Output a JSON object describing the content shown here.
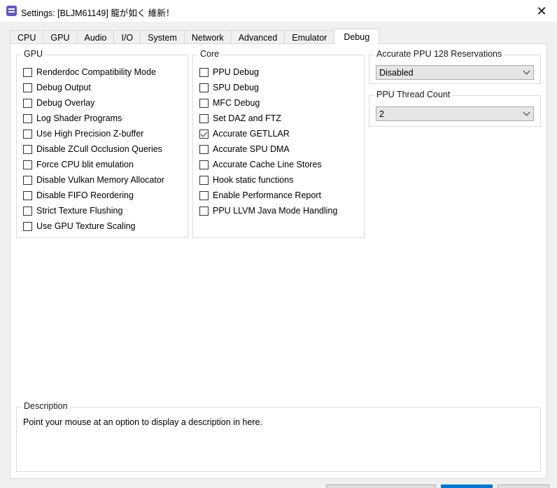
{
  "window": {
    "title": "Settings: [BLJM61149] 龍が如く 維新！",
    "close_glyph": "✕"
  },
  "tabs": [
    {
      "label": "CPU",
      "active": false
    },
    {
      "label": "GPU",
      "active": false
    },
    {
      "label": "Audio",
      "active": false
    },
    {
      "label": "I/O",
      "active": false
    },
    {
      "label": "System",
      "active": false
    },
    {
      "label": "Network",
      "active": false
    },
    {
      "label": "Advanced",
      "active": false
    },
    {
      "label": "Emulator",
      "active": false
    },
    {
      "label": "Debug",
      "active": true
    }
  ],
  "gpu_group": {
    "title": "GPU",
    "options": [
      {
        "label": "Renderdoc Compatibility Mode",
        "checked": false
      },
      {
        "label": "Debug Output",
        "checked": false
      },
      {
        "label": "Debug Overlay",
        "checked": false
      },
      {
        "label": "Log Shader Programs",
        "checked": false
      },
      {
        "label": "Use High Precision Z-buffer",
        "checked": false
      },
      {
        "label": "Disable ZCull Occlusion Queries",
        "checked": false
      },
      {
        "label": "Force CPU blit emulation",
        "checked": false
      },
      {
        "label": "Disable Vulkan Memory Allocator",
        "checked": false
      },
      {
        "label": "Disable FIFO Reordering",
        "checked": false
      },
      {
        "label": "Strict Texture Flushing",
        "checked": false
      },
      {
        "label": "Use GPU Texture Scaling",
        "checked": false
      }
    ]
  },
  "core_group": {
    "title": "Core",
    "options": [
      {
        "label": "PPU Debug",
        "checked": false
      },
      {
        "label": "SPU Debug",
        "checked": false
      },
      {
        "label": "MFC Debug",
        "checked": false
      },
      {
        "label": "Set DAZ and FTZ",
        "checked": false
      },
      {
        "label": "Accurate GETLLAR",
        "checked": true
      },
      {
        "label": "Accurate SPU DMA",
        "checked": false
      },
      {
        "label": "Accurate Cache Line Stores",
        "checked": false
      },
      {
        "label": "Hook static functions",
        "checked": false
      },
      {
        "label": "Enable Performance Report",
        "checked": false
      },
      {
        "label": "PPU LLVM Java Mode Handling",
        "checked": false
      }
    ]
  },
  "ppu_reservations": {
    "title": "Accurate PPU 128 Reservations",
    "value": "Disabled"
  },
  "ppu_threads": {
    "title": "PPU Thread Count",
    "value": "2"
  },
  "description": {
    "title": "Description",
    "text": "Point your mouse at an option to display a description in here."
  },
  "colors": {
    "accent": "#0078d7",
    "window_bg": "#f0f0f0",
    "panel_bg": "#ffffff",
    "app_icon": "#5f55c8"
  }
}
